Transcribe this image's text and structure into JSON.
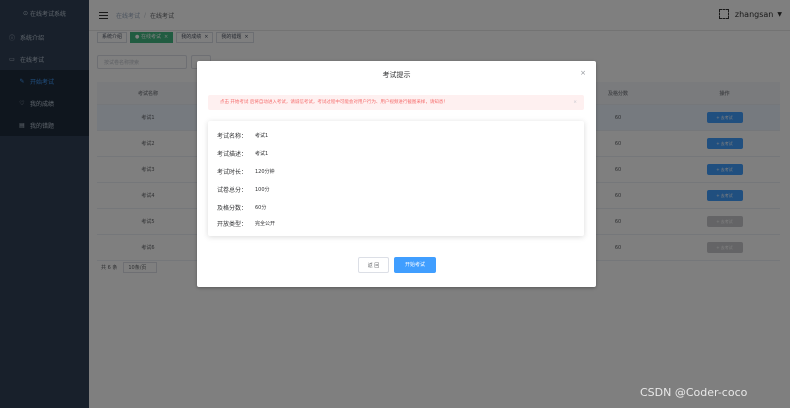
{
  "sidebar": {
    "logo": "在线考试系统",
    "items": [
      {
        "label": "系统介绍",
        "icon": "info-icon"
      },
      {
        "label": "在线考试",
        "icon": "exam-icon"
      }
    ],
    "subitems": [
      {
        "label": "开始考试",
        "icon": "pen-icon",
        "active": true
      },
      {
        "label": "我的成绩",
        "icon": "heart-icon",
        "active": false
      },
      {
        "label": "我的错题",
        "icon": "book-icon",
        "active": false
      }
    ]
  },
  "header": {
    "breadcrumb": [
      "在线考试",
      "在线考试"
    ],
    "user": "zhangsan"
  },
  "tags": [
    {
      "label": "系统介绍",
      "active": false,
      "closable": false
    },
    {
      "label": "在线考试",
      "active": true,
      "closable": true
    },
    {
      "label": "我的成绩",
      "active": false,
      "closable": true
    },
    {
      "label": "我的错题",
      "active": false,
      "closable": true
    }
  ],
  "filter": {
    "placeholder": "按试卷名称搜索"
  },
  "table": {
    "headers": [
      "考试名称",
      "",
      "",
      "",
      "",
      "及格分数",
      "操作"
    ],
    "rows": [
      {
        "name": "考试1",
        "pass": "60",
        "action": "+ 去考试",
        "enabled": true
      },
      {
        "name": "考试2",
        "pass": "60",
        "action": "+ 去考试",
        "enabled": true
      },
      {
        "name": "考试3",
        "pass": "60",
        "action": "+ 去考试",
        "enabled": true
      },
      {
        "name": "考试4",
        "pass": "60",
        "action": "+ 去考试",
        "enabled": true
      },
      {
        "name": "考试5",
        "pass": "60",
        "action": "+ 去考试",
        "enabled": false
      },
      {
        "name": "考试6",
        "pass": "60",
        "action": "+ 去考试",
        "enabled": false
      }
    ]
  },
  "pager": {
    "total": "共 6 条",
    "size": "10条/页"
  },
  "dialog": {
    "title": "考试提示",
    "alert": "点击 开始考试 后将自动进入考试，请诚信考试，考试过程中可能会对用户行为、用户视频进行截图采样，请知悉！",
    "fields": [
      {
        "k": "考试名称：",
        "v": "考试1"
      },
      {
        "k": "考试描述：",
        "v": "考试1"
      },
      {
        "k": "考试时长：",
        "v": "120分钟"
      },
      {
        "k": "试卷总分：",
        "v": "100分"
      },
      {
        "k": "及格分数：",
        "v": "60分"
      },
      {
        "k": "开放类型：",
        "v": "完全公开"
      }
    ],
    "back_label": "返 回",
    "start_label": "开始考试"
  },
  "watermark": "CSDN @Coder-coco"
}
